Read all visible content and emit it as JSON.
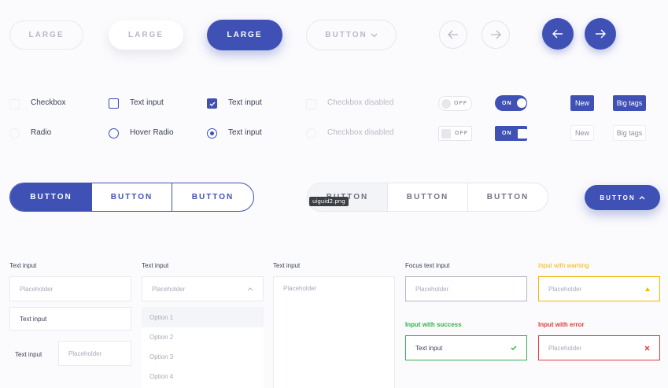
{
  "colors": {
    "accent": "#3f51b5",
    "warning": "#f7b500",
    "success": "#35b04a",
    "error": "#e23b3b"
  },
  "row1": {
    "large_ghost": "LARGE",
    "large_soft": "LARGE",
    "large_solid": "LARGE",
    "button_dropdown": "BUTTON"
  },
  "checks": {
    "checkbox": "Checkbox",
    "cb_hover_label": "Text input",
    "cb_checked_label": "Text input",
    "cb_disabled_label": "Checkbox disabled",
    "radio": "Radio",
    "radio_hover_label": "Hover Radio",
    "radio_checked_label": "Text input",
    "radio_disabled_label": "Checkbox disabled"
  },
  "toggles": {
    "off": "OFF",
    "on": "ON",
    "off2": "OFF",
    "on2": "ON"
  },
  "tags": {
    "new_solid": "New",
    "big_solid": "Big tags",
    "new_ghost": "New",
    "big_ghost": "Big tags"
  },
  "segmented1": [
    "BUTTON",
    "BUTTON",
    "BUTTON"
  ],
  "segmented2": [
    "BUTTON",
    "BUTTON",
    "BUTTON"
  ],
  "tooltip": "uiguid2.png",
  "dropdown_button": "BUTTON",
  "inputs": {
    "col1_label": "Text input",
    "col1_placeholder": "Placeholder",
    "col1_value": "Text input",
    "col1_inline_label": "Text input",
    "col1_inline_placeholder": "Placeholder",
    "col2_label": "Text input",
    "col2_placeholder": "Placeholder",
    "options": [
      "Option 1",
      "Option 2",
      "Option 3",
      "Option 4"
    ],
    "col3_label": "Text input",
    "col3_placeholder": "Placeholder",
    "focus_label": "Focus text input",
    "focus_placeholder": "Placeholder",
    "warning_label": "Input with warning",
    "warning_placeholder": "Placeholder",
    "success_label": "Input with success",
    "success_value": "Text input",
    "error_label": "Input with error",
    "error_placeholder": "Placeholder"
  }
}
